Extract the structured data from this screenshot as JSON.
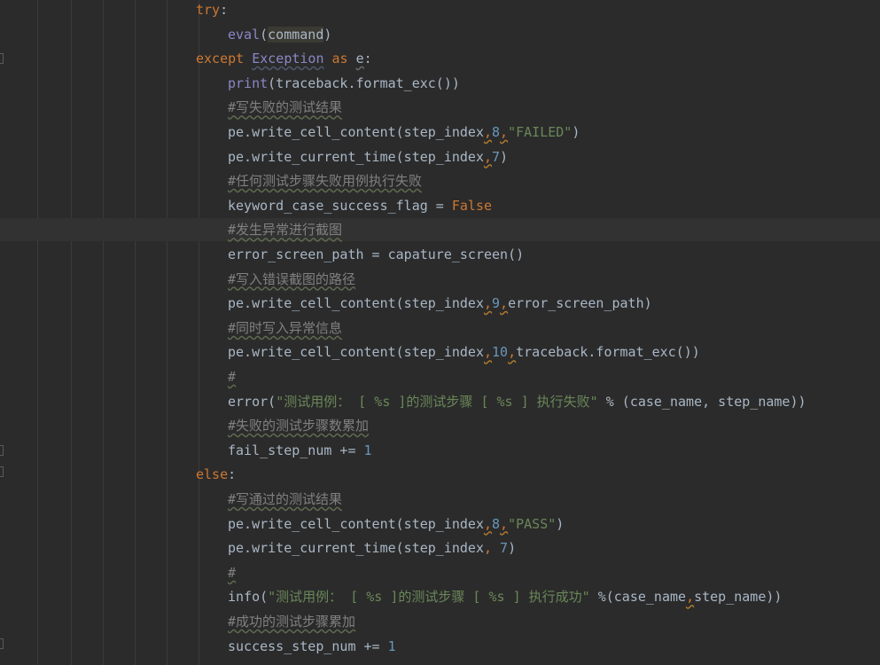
{
  "colors": {
    "background": "#2b2b2b",
    "keyword": "#cc7832",
    "builtin": "#8888c6",
    "number": "#6897bb",
    "string": "#6a8759",
    "comment": "#808080",
    "default": "#a9b7c6"
  },
  "lines": [
    {
      "indent": 221,
      "tokens": [
        {
          "t": "try",
          "c": "kw"
        },
        {
          "t": ":",
          "c": "txt"
        }
      ]
    },
    {
      "indent": 257,
      "tokens": [
        {
          "t": "eval",
          "c": "bi"
        },
        {
          "t": "(",
          "c": "txt"
        },
        {
          "t": "command",
          "c": "hl"
        },
        {
          "t": ")",
          "c": "txt"
        }
      ]
    },
    {
      "indent": 221,
      "tokens": [
        {
          "t": "except ",
          "c": "kw"
        },
        {
          "t": "Exception",
          "c": "cls"
        },
        {
          "t": " as ",
          "c": "kw"
        },
        {
          "t": "e",
          "c": "var-e"
        },
        {
          "t": ":",
          "c": "txt"
        }
      ]
    },
    {
      "indent": 257,
      "tokens": [
        {
          "t": "print",
          "c": "bi"
        },
        {
          "t": "(traceback.format_exc())",
          "c": "txt"
        }
      ]
    },
    {
      "indent": 257,
      "tokens": [
        {
          "t": "#写失败的测试结果",
          "c": "cmt"
        }
      ]
    },
    {
      "indent": 257,
      "tokens": [
        {
          "t": "pe.write_cell_content(step_index",
          "c": "txt"
        },
        {
          "t": ",",
          "c": "kw sq"
        },
        {
          "t": "8",
          "c": "num"
        },
        {
          "t": ",",
          "c": "kw sq"
        },
        {
          "t": "\"FAILED\"",
          "c": "str"
        },
        {
          "t": ")",
          "c": "txt"
        }
      ]
    },
    {
      "indent": 257,
      "tokens": [
        {
          "t": "pe.write_current_time(step_index",
          "c": "txt"
        },
        {
          "t": ",",
          "c": "kw sq"
        },
        {
          "t": "7",
          "c": "num"
        },
        {
          "t": ")",
          "c": "txt"
        }
      ]
    },
    {
      "indent": 257,
      "tokens": [
        {
          "t": "#任何测试步骤失败用例执行失败",
          "c": "cmt"
        }
      ]
    },
    {
      "indent": 257,
      "tokens": [
        {
          "t": "keyword_case_success_flag = ",
          "c": "txt"
        },
        {
          "t": "False",
          "c": "kw"
        }
      ]
    },
    {
      "indent": 257,
      "current": true,
      "tokens": [
        {
          "t": "#发生异常进行截图",
          "c": "cmt"
        }
      ]
    },
    {
      "indent": 257,
      "tokens": [
        {
          "t": "error_screen_path = capature_screen()",
          "c": "txt"
        }
      ]
    },
    {
      "indent": 257,
      "tokens": [
        {
          "t": "#写入错误截图的路径",
          "c": "cmt"
        }
      ]
    },
    {
      "indent": 257,
      "tokens": [
        {
          "t": "pe.write_cell_content(step_index",
          "c": "txt"
        },
        {
          "t": ",",
          "c": "kw sq"
        },
        {
          "t": "9",
          "c": "num"
        },
        {
          "t": ",",
          "c": "kw sq"
        },
        {
          "t": "error_screen_path)",
          "c": "txt"
        }
      ]
    },
    {
      "indent": 257,
      "tokens": [
        {
          "t": "#同时写入异常信息",
          "c": "cmt"
        }
      ]
    },
    {
      "indent": 257,
      "tokens": [
        {
          "t": "pe.write_cell_content(step_index",
          "c": "txt"
        },
        {
          "t": ",",
          "c": "kw sq"
        },
        {
          "t": "10",
          "c": "num"
        },
        {
          "t": ",",
          "c": "kw sq"
        },
        {
          "t": "traceback.format_exc())",
          "c": "txt"
        }
      ]
    },
    {
      "indent": 257,
      "tokens": [
        {
          "t": "#",
          "c": "cmt"
        }
      ]
    },
    {
      "indent": 257,
      "tokens": [
        {
          "t": "error(",
          "c": "txt"
        },
        {
          "t": "\"测试用例： [ %s ]的测试步骤 [ %s ] 执行失败\"",
          "c": "str"
        },
        {
          "t": " % (case_name, step_name))",
          "c": "txt"
        }
      ]
    },
    {
      "indent": 257,
      "tokens": [
        {
          "t": "#失败的测试步骤数累加",
          "c": "cmt"
        }
      ]
    },
    {
      "indent": 257,
      "tokens": [
        {
          "t": "fail_step_num += ",
          "c": "txt"
        },
        {
          "t": "1",
          "c": "num"
        }
      ]
    },
    {
      "indent": 221,
      "tokens": [
        {
          "t": "else",
          "c": "kw"
        },
        {
          "t": ":",
          "c": "txt"
        }
      ]
    },
    {
      "indent": 257,
      "tokens": [
        {
          "t": "#写通过的测试结果",
          "c": "cmt"
        }
      ]
    },
    {
      "indent": 257,
      "tokens": [
        {
          "t": "pe.write_cell_content(step_index",
          "c": "txt"
        },
        {
          "t": ",",
          "c": "kw sq"
        },
        {
          "t": "8",
          "c": "num"
        },
        {
          "t": ",",
          "c": "kw sq"
        },
        {
          "t": "\"PASS\"",
          "c": "str"
        },
        {
          "t": ")",
          "c": "txt"
        }
      ]
    },
    {
      "indent": 257,
      "tokens": [
        {
          "t": "pe.write_current_time(step_index",
          "c": "txt"
        },
        {
          "t": ", ",
          "c": "kw"
        },
        {
          "t": "7",
          "c": "num"
        },
        {
          "t": ")",
          "c": "txt"
        }
      ]
    },
    {
      "indent": 257,
      "tokens": [
        {
          "t": "#",
          "c": "cmt"
        }
      ]
    },
    {
      "indent": 257,
      "tokens": [
        {
          "t": "info(",
          "c": "txt"
        },
        {
          "t": "\"测试用例： [ %s ]的测试步骤 [ %s ] 执行成功\"",
          "c": "str"
        },
        {
          "t": " %(case_name",
          "c": "txt"
        },
        {
          "t": ",",
          "c": "kw sq"
        },
        {
          "t": "step_name))",
          "c": "txt"
        }
      ]
    },
    {
      "indent": 257,
      "tokens": [
        {
          "t": "#成功的测试步骤累加",
          "c": "cmt"
        }
      ]
    },
    {
      "indent": 257,
      "tokens": [
        {
          "t": "success_step_num += ",
          "c": "txt"
        },
        {
          "t": "1",
          "c": "num"
        }
      ]
    }
  ]
}
